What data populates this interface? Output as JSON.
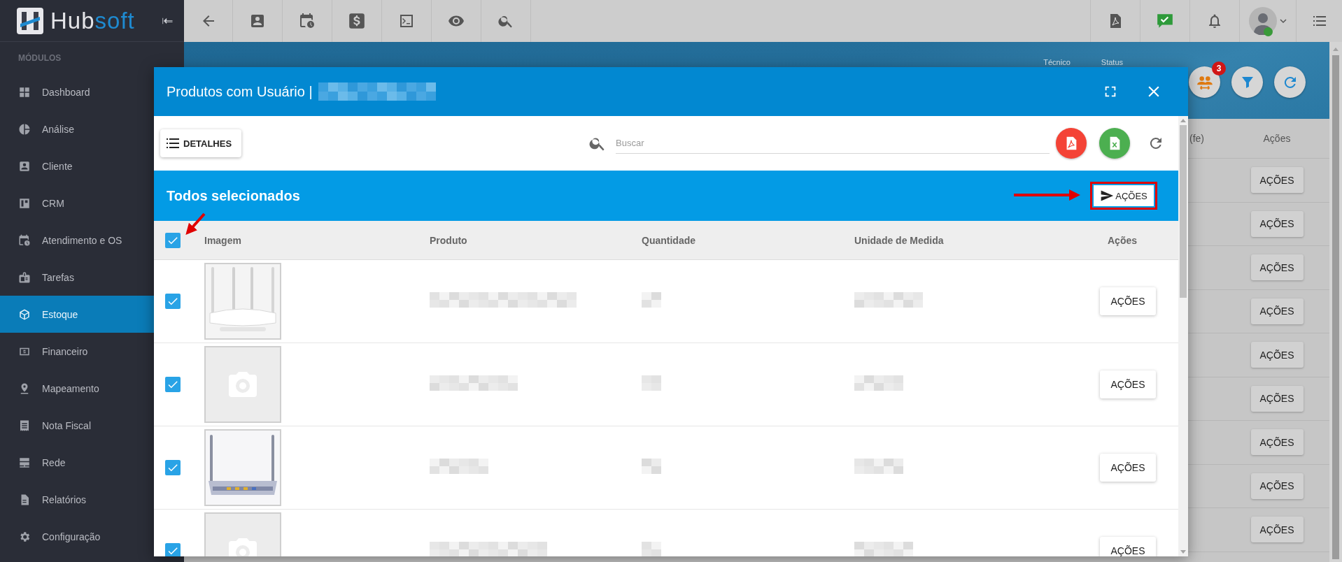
{
  "sidebar": {
    "logo_text": [
      "Hub",
      "soft"
    ],
    "section": "MÓDULOS",
    "items": [
      {
        "label": "Dashboard",
        "selected": false
      },
      {
        "label": "Análise",
        "selected": false
      },
      {
        "label": "Cliente",
        "selected": false
      },
      {
        "label": "CRM",
        "selected": false
      },
      {
        "label": "Atendimento e OS",
        "selected": false
      },
      {
        "label": "Tarefas",
        "selected": false
      },
      {
        "label": "Estoque",
        "selected": true
      },
      {
        "label": "Financeiro",
        "selected": false
      },
      {
        "label": "Mapeamento",
        "selected": false
      },
      {
        "label": "Nota Fiscal",
        "selected": false
      },
      {
        "label": "Rede",
        "selected": false
      },
      {
        "label": "Relatórios",
        "selected": false
      },
      {
        "label": "Configuração",
        "selected": false
      }
    ]
  },
  "page": {
    "filters": [
      "Técnico",
      "Status"
    ],
    "badge": "3",
    "table": {
      "columns": [
        "(fe)",
        "Ações"
      ],
      "rows": [
        {
          "action": "AÇÕES"
        },
        {
          "action": "AÇÕES"
        },
        {
          "action": "AÇÕES"
        },
        {
          "action": "AÇÕES"
        },
        {
          "action": "AÇÕES"
        },
        {
          "action": "AÇÕES"
        },
        {
          "action": "AÇÕES"
        },
        {
          "action": "AÇÕES"
        },
        {
          "action": "AÇÕES"
        }
      ]
    }
  },
  "modal": {
    "title": "Produtos com Usuário |",
    "toolbar": {
      "details_button": "DETALHES",
      "search_placeholder": "Buscar"
    },
    "selection_bar": {
      "text": "Todos selecionados",
      "action": "AÇÕES"
    },
    "table": {
      "select_all": {
        "checked": true
      },
      "columns": [
        "Imagem",
        "Produto",
        "Quantidade",
        "Unidade de Medida",
        "Ações"
      ],
      "rows": [
        {
          "selected": true,
          "action": "AÇÕES"
        },
        {
          "kind": "placeholder",
          "selected": true,
          "action": "AÇÕES"
        },
        {
          "selected": true,
          "action": "AÇÕES"
        },
        {
          "kind": "placeholder",
          "selected": true,
          "action": "AÇÕES"
        }
      ]
    }
  }
}
